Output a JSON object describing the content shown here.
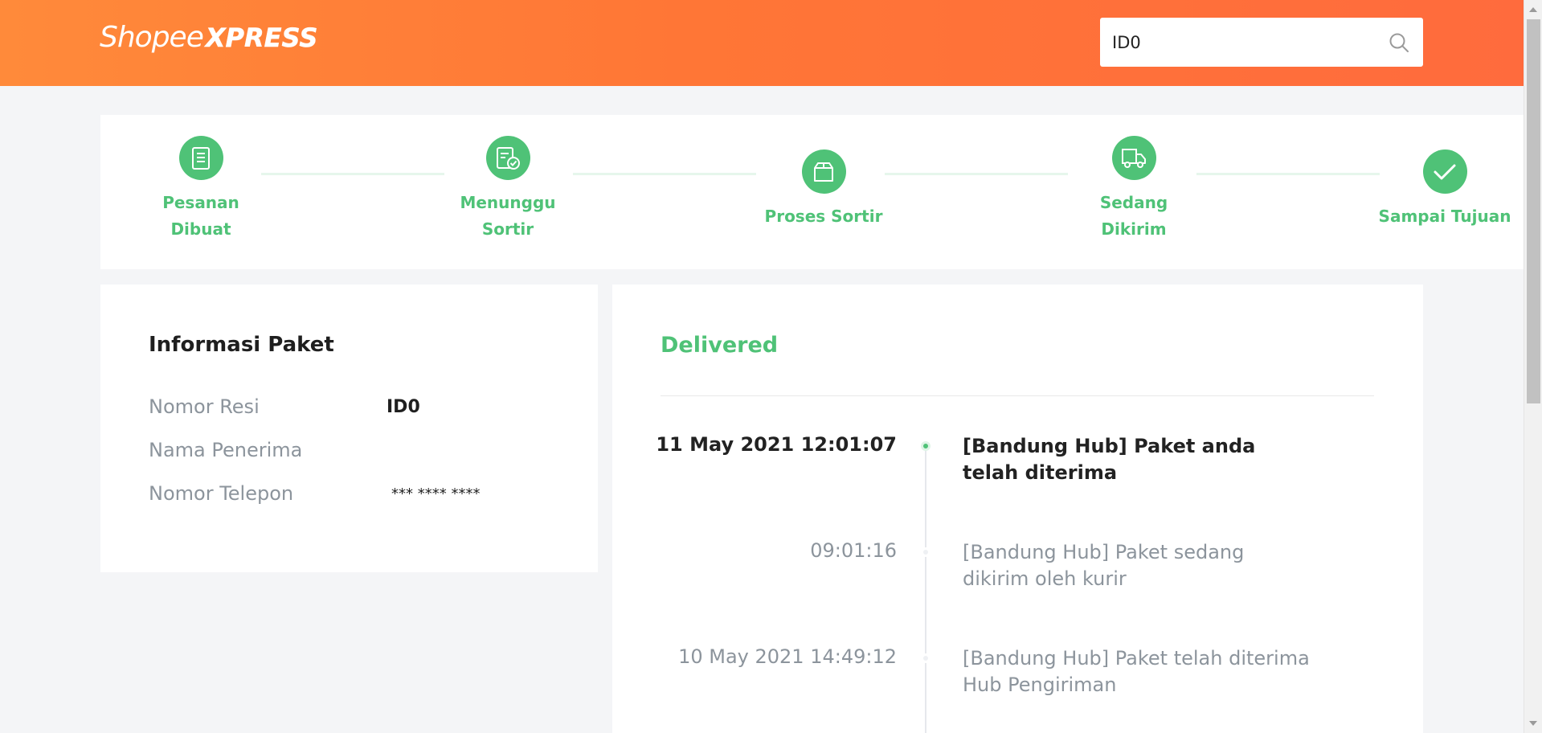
{
  "header": {
    "logo_shopee": "Shopee",
    "logo_xpress": "XPRESS",
    "search_value": "ID0"
  },
  "steps": [
    {
      "label": "Pesanan\nDibuat",
      "icon": "document-icon"
    },
    {
      "label": "Menunggu\nSortir",
      "icon": "document-check-icon"
    },
    {
      "label": "Proses Sortir",
      "icon": "box-icon"
    },
    {
      "label": "Sedang\nDikirim",
      "icon": "truck-icon"
    },
    {
      "label": "Sampai Tujuan",
      "icon": "check-icon"
    }
  ],
  "info": {
    "title": "Informasi Paket",
    "rows": [
      {
        "label": "Nomor Resi",
        "value": "ID0"
      },
      {
        "label": "Nama Penerima",
        "value": ""
      },
      {
        "label": "Nomor Telepon",
        "value": "*** **** ****"
      }
    ]
  },
  "tracking": {
    "status": "Delivered",
    "events": [
      {
        "time": "11 May 2021 12:01:07",
        "desc": "[Bandung Hub] Paket anda telah diterima",
        "active": true
      },
      {
        "time": "09:01:16",
        "desc": "[Bandung Hub] Paket sedang dikirim oleh kurir",
        "active": false
      },
      {
        "time": "10 May 2021 14:49:12",
        "desc": "[Bandung Hub] Paket telah diterima Hub Pengiriman",
        "active": false
      }
    ]
  },
  "colors": {
    "accent_green": "#4fc277",
    "header_orange": "#ff7636"
  }
}
